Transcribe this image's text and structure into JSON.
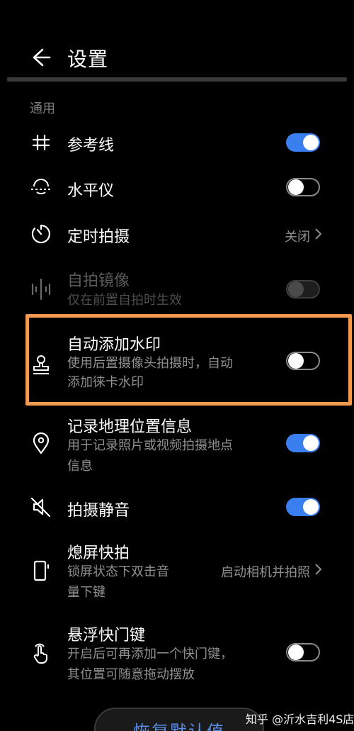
{
  "header": {
    "back_icon": "arrow-left-icon",
    "title": "设置"
  },
  "section": {
    "label": "通用"
  },
  "rows": [
    {
      "id": "grid",
      "icon": "grid-hash-icon",
      "title": "参考线",
      "toggle": "on"
    },
    {
      "id": "level",
      "icon": "level-icon",
      "title": "水平仪",
      "toggle": "off"
    },
    {
      "id": "timer",
      "icon": "timer-icon",
      "title": "定时拍摄",
      "value": "关闭"
    },
    {
      "id": "mirror",
      "icon": "mirror-icon",
      "title": "自拍镜像",
      "subtitle": [
        "仅在前置自拍时生效"
      ],
      "toggle": "disabled"
    },
    {
      "id": "watermark",
      "icon": "stamp-icon",
      "title": "自动添加水印",
      "subtitle": [
        "使用后置摄像头拍摄时，自动",
        "添加徕卡水印"
      ],
      "toggle": "off"
    },
    {
      "id": "location",
      "icon": "location-pin-icon",
      "title": "记录地理位置信息",
      "subtitle": [
        "用于记录照片或视频拍摄地点",
        "信息"
      ],
      "toggle": "on"
    },
    {
      "id": "mute",
      "icon": "mute-icon",
      "title": "拍摄静音",
      "toggle": "on"
    },
    {
      "id": "snapshot",
      "icon": "phone-snapshot-icon",
      "title": "熄屏快拍",
      "subtitle": [
        "锁屏状态下双击音",
        "量下键"
      ],
      "value": "启动相机并拍照"
    },
    {
      "id": "floating",
      "icon": "tap-hand-icon",
      "title": "悬浮快门键",
      "subtitle": [
        "开启后可再添加一个快门键，",
        "其位置可随意拖动摆放"
      ],
      "toggle": "off"
    }
  ],
  "restore_button": {
    "label": "恢复默认值"
  },
  "watermark": {
    "text": "知乎 @沂水吉利4S店"
  },
  "colors": {
    "accent": "#3a7ff0",
    "highlight": "#f39a51",
    "background": "#000000"
  }
}
